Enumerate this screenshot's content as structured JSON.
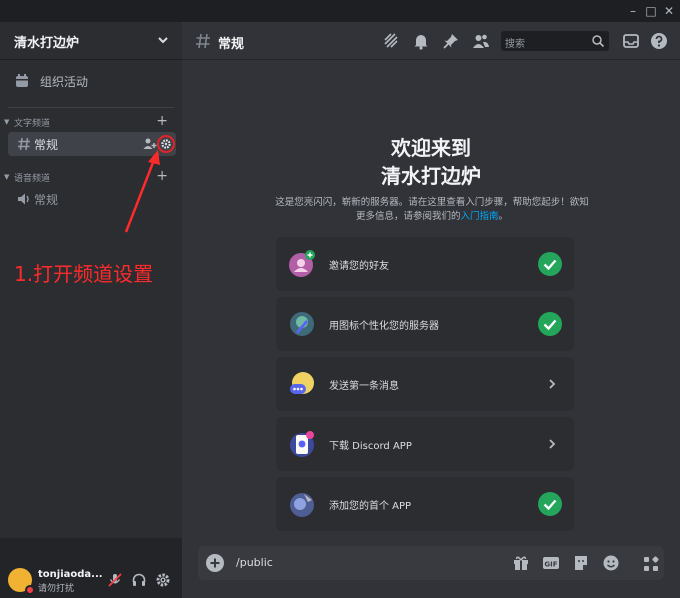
{
  "server": {
    "name": "清水打边炉"
  },
  "sidebar": {
    "events_label": "组织活动",
    "text_category": "文字频道",
    "voice_category": "语音频道",
    "text_channels": [
      {
        "name": "常规"
      }
    ],
    "voice_channels": [
      {
        "name": "常规"
      }
    ]
  },
  "annotation": {
    "text": "1.打开频道设置",
    "color": "#ff2a2a"
  },
  "user": {
    "name": "tonjiaoda...",
    "status": "请勿打扰"
  },
  "channel": {
    "name": "常规"
  },
  "search": {
    "placeholder": "搜索"
  },
  "welcome": {
    "title_line1": "欢迎来到",
    "title_line2": "清水打边炉",
    "desc": "这是您亮闪闪，崭新的服务器。请在这里查看入门步骤，帮助您起步！欲知更多信息，请参阅我们的",
    "link": "入门指南",
    "desc_end": "。"
  },
  "checklist": [
    {
      "label": "邀请您的好友",
      "done": true,
      "icon": "invite-friends-icon"
    },
    {
      "label": "用图标个性化您的服务器",
      "done": true,
      "icon": "personalize-server-icon"
    },
    {
      "label": "发送第一条消息",
      "done": false,
      "icon": "send-message-icon"
    },
    {
      "label": "下载 Discord APP",
      "done": false,
      "icon": "download-app-icon"
    },
    {
      "label": "添加您的首个 APP",
      "done": true,
      "icon": "add-app-icon"
    }
  ],
  "composer": {
    "value": "/public"
  },
  "colors": {
    "accent_green": "#23a55a",
    "link_blue": "#00a8fc",
    "dnd_red": "#f23f43"
  }
}
